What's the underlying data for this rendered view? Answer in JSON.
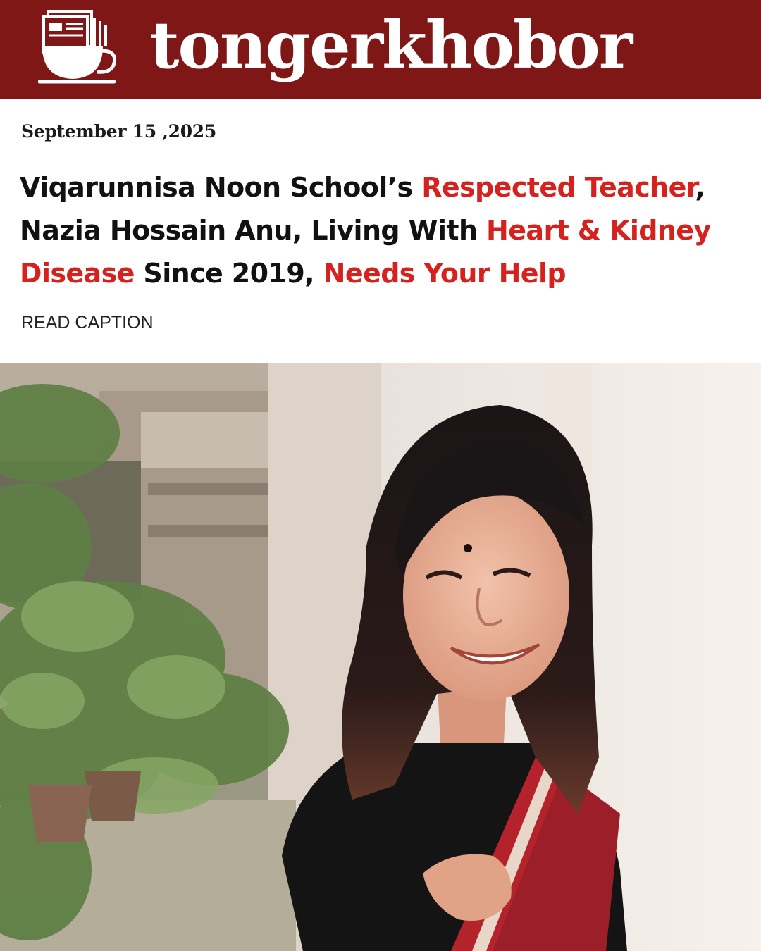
{
  "header": {
    "brand_name": "tongerkhobor",
    "background_color": "#7e1716",
    "logo_icon": "newspaper-teacup-icon"
  },
  "article": {
    "date": "September 15 ,2025",
    "headline": {
      "accent_color": "#d6221f",
      "line1": {
        "p1": "Viqarunnisa Noon School’s ",
        "p2": "Respected Teacher",
        "p3": ","
      },
      "line2": {
        "p1": "Nazia Hossain Anu, Living With ",
        "p2": "Heart & Kidney"
      },
      "line3": {
        "p1": "Disease",
        "p2": " Since 2019, ",
        "p3": "Needs Your Help"
      }
    },
    "read_caption_label": "READ CAPTION"
  },
  "photo": {
    "subject": "portrait-photo"
  }
}
